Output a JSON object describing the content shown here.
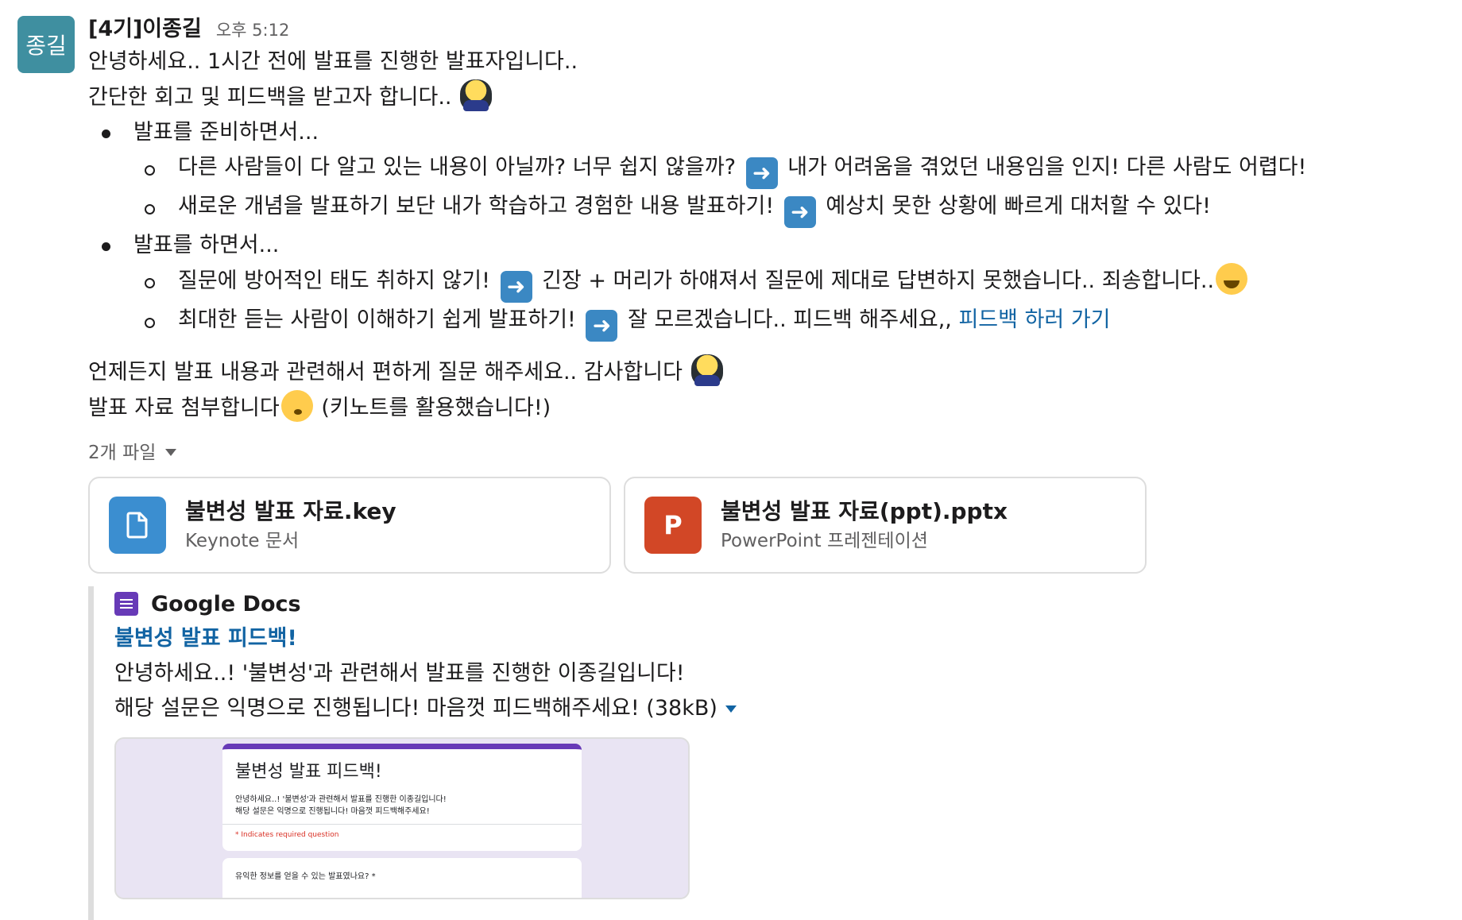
{
  "avatar": {
    "text": "종길",
    "color": "#3f8fa0"
  },
  "message": {
    "author": "[4기]이종길",
    "time": "오후 5:12",
    "lines": [
      "안녕하세요.. 1시간 전에 발표를 진행한 발표자입니다..",
      "간단한 회고 및 피드백을 받고자 합니다.. "
    ],
    "bullets": [
      {
        "text": "발표를 준비하면서...",
        "sub": [
          {
            "before": "다른 사람들이 다 알고 있는 내용이 아닐까? 너무 쉽지 않을까? ",
            "after": " 내가 어려움을 겪었던 내용임을 인지! 다른 사람도 어렵다!"
          },
          {
            "before": "새로운 개념을 발표하기 보단 내가 학습하고 경험한 내용 발표하기! ",
            "after": " 예상치 못한 상황에 빠르게 대처할 수 있다!"
          }
        ]
      },
      {
        "text": "발표를 하면서...",
        "sub": [
          {
            "before": "질문에 방어적인 태도 취하지 않기! ",
            "after": " 긴장 + 머리가 하얘져서 질문에 제대로 답변하지 못했습니다.. 죄송합니다.."
          },
          {
            "before": "최대한 듣는 사람이 이해하기 쉽게 발표하기! ",
            "after": " 잘 모르겠습니다.. 피드백 해주세요,, ",
            "link": "피드백 하러 가기"
          }
        ]
      }
    ],
    "closing": [
      "언제든지 발표 내용과 관련해서 편하게 질문 해주세요.. 감사합니다 ",
      {
        "before": "발표 자료 첨부합니다",
        "after": " (키노트를 활용했습니다!)"
      }
    ],
    "emoji_names": [
      "bowing-person",
      "arrow-right",
      "face-with-tears-of-joy",
      "kissing-face"
    ]
  },
  "files": {
    "label": "2개 파일",
    "items": [
      {
        "icon": "document-icon",
        "name": "불변성 발표 자료.key",
        "type": "Keynote 문서",
        "color": "#3b8ed0"
      },
      {
        "icon": "P",
        "name": "불변성 발표 자료(ppt).pptx",
        "type": "PowerPoint 프레젠테이션",
        "color": "#d24726"
      }
    ]
  },
  "unfurl": {
    "service": "Google Docs",
    "title": "불변성 발표 피드백!",
    "desc1": "안녕하세요..! '불변성'과 관련해서 발표를 진행한 이종길입니다!",
    "desc2": "해당 설문은 익명으로 진행됩니다! 마음껏 피드백해주세요! (38kB)",
    "preview": {
      "form_title": "불변성 발표 피드백!",
      "form_desc1": "안녕하세요..! '불변성'과 관련해서 발표를 진행한 이종길입니다!",
      "form_desc2": "해당 설문은 익명으로 진행됩니다! 마음껏 피드백해주세요!",
      "required_note": "* Indicates required question",
      "question": "유익한 정보를 얻을 수 있는 발표였나요? *"
    }
  }
}
